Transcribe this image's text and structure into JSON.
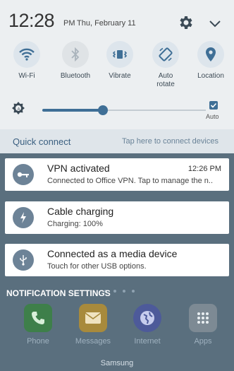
{
  "status": {
    "time": "12:28",
    "ampm": "PM",
    "date": "Thu, February 11"
  },
  "quick_tiles": [
    {
      "label": "Wi-Fi",
      "icon": "wifi-icon",
      "active": true
    },
    {
      "label": "Bluetooth",
      "icon": "bluetooth-icon",
      "active": false
    },
    {
      "label": "Vibrate",
      "icon": "vibrate-icon",
      "active": true
    },
    {
      "label": "Auto rotate",
      "icon": "auto-rotate-icon",
      "active": true
    },
    {
      "label": "Location",
      "icon": "location-icon",
      "active": true
    }
  ],
  "brightness": {
    "level": 0.37,
    "auto_label": "Auto",
    "auto_checked": true
  },
  "quick_connect": {
    "title": "Quick connect",
    "hint": "Tap here to connect devices"
  },
  "notifications": [
    {
      "title": "VPN activated",
      "subtitle": "Connected to Office VPN. Tap to manage the n..",
      "time": "12:26 PM",
      "icon": "key-icon"
    },
    {
      "title": "Cable charging",
      "subtitle": "Charging: 100%",
      "time": "",
      "icon": "lightning-icon"
    },
    {
      "title": "Connected as a media device",
      "subtitle": "Touch for other USB options.",
      "time": "",
      "icon": "usb-icon"
    }
  ],
  "notification_settings_label": "NOTIFICATION SETTINGS",
  "dock": [
    {
      "label": "Phone",
      "icon": "phone-icon",
      "color": "#3e7f4a"
    },
    {
      "label": "Messages",
      "icon": "messages-icon",
      "color": "#a88a3c"
    },
    {
      "label": "Internet",
      "icon": "internet-icon",
      "color": "#4d5a9a"
    },
    {
      "label": "Apps",
      "icon": "apps-icon",
      "color": "#7d8a94"
    }
  ],
  "samsung_label": "Samsung",
  "colors": {
    "accent": "#3f6f96",
    "panel_bg": "#eceff1",
    "icon_bg": "#6d8397"
  }
}
